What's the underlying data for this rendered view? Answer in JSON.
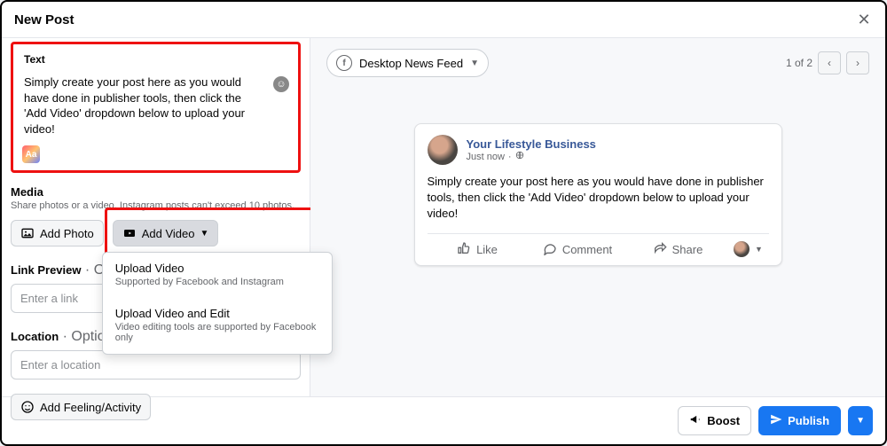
{
  "header": {
    "title": "New Post"
  },
  "textCard": {
    "label": "Text",
    "body": "Simply create your post here as you would have done in publisher tools, then click the 'Add Video' dropdown below to upload your video!"
  },
  "media": {
    "label": "Media",
    "sub": "Share photos or a video. Instagram posts can't exceed 10 photos.",
    "addPhoto": "Add Photo",
    "addVideo": "Add Video",
    "dropdown": [
      {
        "title": "Upload Video",
        "sub": "Supported by Facebook and Instagram"
      },
      {
        "title": "Upload Video and Edit",
        "sub": "Video editing tools are supported by Facebook only"
      }
    ]
  },
  "linkPreview": {
    "label": "Link Preview",
    "optional": " · Optional",
    "placeholder": "Enter a link"
  },
  "location": {
    "label": "Location",
    "optional": " · Optional",
    "placeholder": "Enter a location"
  },
  "feeling": {
    "label": "Add Feeling/Activity"
  },
  "preview": {
    "feedName": "Desktop News Feed",
    "paging": "1 of 2",
    "post": {
      "pageName": "Your Lifestyle Business",
      "timestamp": "Just now",
      "body": "Simply create your post here as you would have done in publisher tools, then click the 'Add Video' dropdown below to upload your video!",
      "like": "Like",
      "comment": "Comment",
      "share": "Share"
    }
  },
  "footer": {
    "boost": "Boost",
    "publish": "Publish"
  }
}
